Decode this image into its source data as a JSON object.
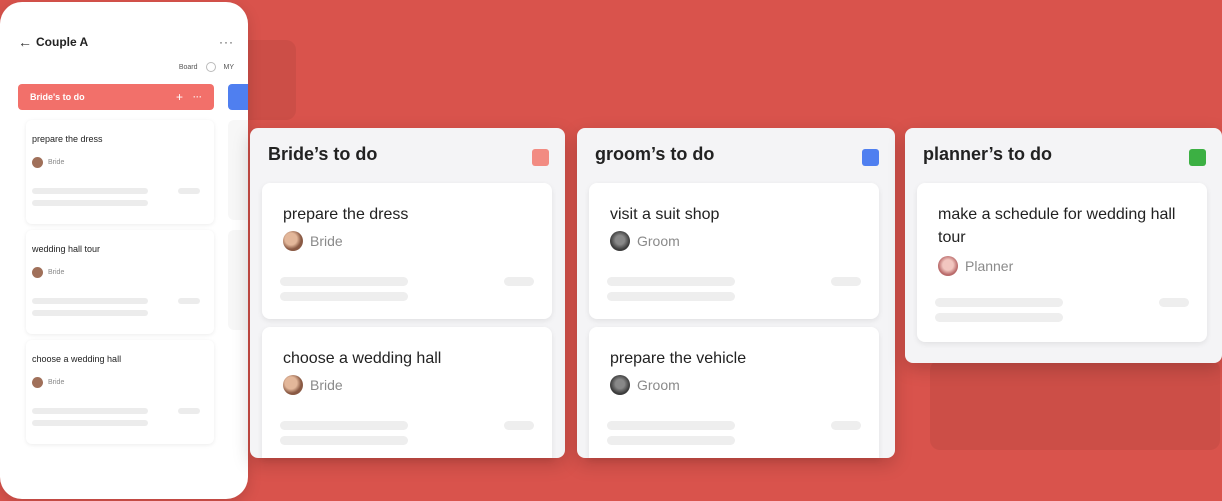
{
  "phone": {
    "title": "Couple A",
    "back_icon": "arrow-left-icon",
    "more_icon": "more-icon",
    "toggle": {
      "board": "Board",
      "my": "MY"
    },
    "column_title": "Bride's to do",
    "cards": [
      {
        "title": "prepare the dress",
        "user": "Bride"
      },
      {
        "title": "wedding hall tour",
        "user": "Bride"
      },
      {
        "title": "choose a wedding hall",
        "user": "Bride"
      }
    ]
  },
  "columns": [
    {
      "title": "Bride’s to do",
      "color": "#f28b82",
      "cards": [
        {
          "title": "prepare the dress",
          "user": "Bride"
        },
        {
          "title": "choose a wedding hall",
          "user": "Bride"
        }
      ]
    },
    {
      "title": "groom’s to do",
      "color": "#4f7ff0",
      "cards": [
        {
          "title": "visit a suit shop",
          "user": "Groom"
        },
        {
          "title": "prepare the vehicle",
          "user": "Groom"
        }
      ]
    },
    {
      "title": "planner’s to do",
      "color": "#3cb043",
      "cards": [
        {
          "title": "make a schedule for wedding hall tour",
          "user": "Planner"
        }
      ]
    }
  ]
}
